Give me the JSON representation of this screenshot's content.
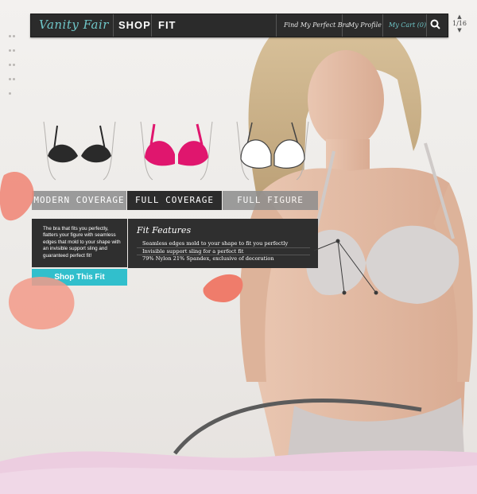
{
  "navbar": {
    "brand": "Vanity Fair",
    "shop": "SHOP",
    "fit": "FIT",
    "find_bra": "Find My Perfect Bra",
    "profile": "My Profile",
    "cart": "My Cart (0)",
    "search_icon": "search-icon"
  },
  "pager": {
    "current": "1",
    "total": "16"
  },
  "tabs": [
    "MODERN COVERAGE",
    "FULL COVERAGE",
    "FULL FIGURE"
  ],
  "description": "The bra that fits you perfectly, flatters your figure with seamless edges that mold to your shape with an invisible support sling and guaranteed perfect fit!",
  "cta": "Shop This Fit",
  "features": {
    "title": "Fit Features",
    "items": [
      "Seamless edges mold to your shape to fit you perfectly",
      "Invisible support sling for a perfect fit",
      "79% Nylon 21% Spandex, exclusive of decoration"
    ]
  },
  "colors": {
    "accent": "#31bfcc",
    "brand": "#6fc6c8",
    "panel": "#2f2f2f",
    "bra_black": "#2a2a2a",
    "bra_pink": "#e0166e",
    "bra_white": "#ffffff",
    "petal": "#f08a7a",
    "wave": "#eccde0"
  }
}
